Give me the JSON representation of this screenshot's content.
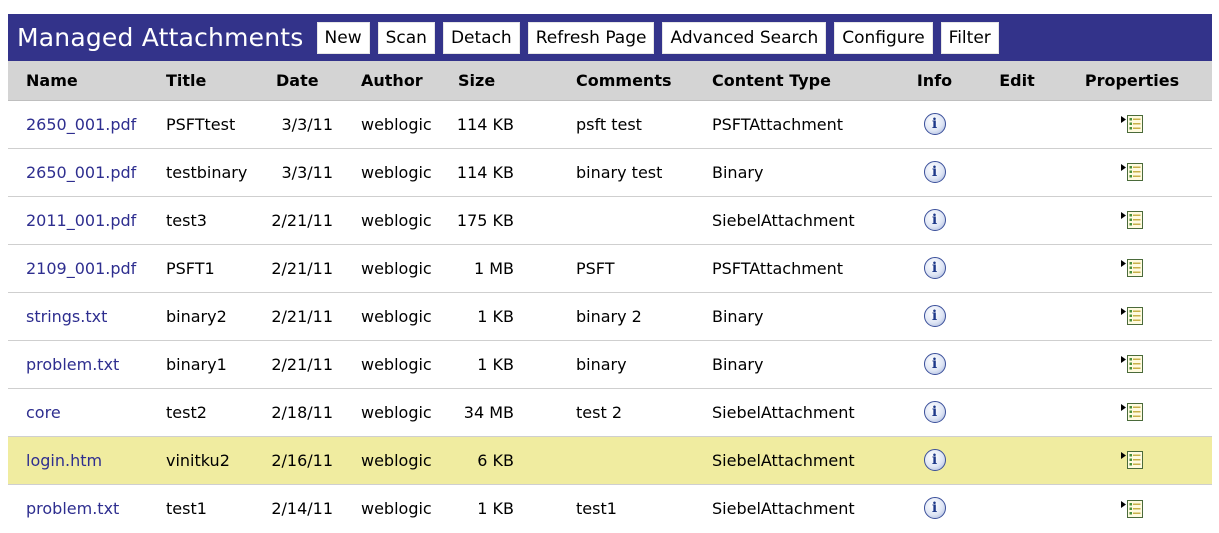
{
  "toolbar": {
    "title": "Managed Attachments",
    "buttons": [
      "New",
      "Scan",
      "Detach",
      "Refresh Page",
      "Advanced Search",
      "Configure",
      "Filter"
    ]
  },
  "table": {
    "headers": {
      "name": "Name",
      "title": "Title",
      "date": "Date",
      "author": "Author",
      "size": "Size",
      "comments": "Comments",
      "content_type": "Content Type",
      "info": "Info",
      "edit": "Edit",
      "properties": "Properties"
    },
    "rows": [
      {
        "name": "2650_001.pdf",
        "title": "PSFTtest",
        "date": "3/3/11",
        "author": "weblogic",
        "size": "114 KB",
        "comments": "psft test",
        "content_type": "PSFTAttachment"
      },
      {
        "name": "2650_001.pdf",
        "title": "testbinary",
        "date": "3/3/11",
        "author": "weblogic",
        "size": "114 KB",
        "comments": "binary test",
        "content_type": "Binary"
      },
      {
        "name": "2011_001.pdf",
        "title": "test3",
        "date": "2/21/11",
        "author": "weblogic",
        "size": "175 KB",
        "comments": "",
        "content_type": "SiebelAttachment"
      },
      {
        "name": "2109_001.pdf",
        "title": "PSFT1",
        "date": "2/21/11",
        "author": "weblogic",
        "size": "1 MB",
        "comments": "PSFT",
        "content_type": "PSFTAttachment"
      },
      {
        "name": "strings.txt",
        "title": "binary2",
        "date": "2/21/11",
        "author": "weblogic",
        "size": "1 KB",
        "comments": "binary 2",
        "content_type": "Binary"
      },
      {
        "name": "problem.txt",
        "title": "binary1",
        "date": "2/21/11",
        "author": "weblogic",
        "size": "1 KB",
        "comments": "binary",
        "content_type": "Binary"
      },
      {
        "name": "core",
        "title": "test2",
        "date": "2/18/11",
        "author": "weblogic",
        "size": "34 MB",
        "comments": "test 2",
        "content_type": "SiebelAttachment"
      },
      {
        "name": "login.htm",
        "title": "vinitku2",
        "date": "2/16/11",
        "author": "weblogic",
        "size": "6 KB",
        "comments": "",
        "content_type": "SiebelAttachment",
        "selected": true
      },
      {
        "name": "problem.txt",
        "title": "test1",
        "date": "2/14/11",
        "author": "weblogic",
        "size": "1 KB",
        "comments": "test1",
        "content_type": "SiebelAttachment"
      }
    ],
    "info_icon": "info-icon",
    "properties_icon": "properties-icon"
  },
  "colors": {
    "title_bar": "#33338a",
    "header_bg": "#d4d4d4",
    "link": "#2e2e8f",
    "selected_row": "#f0eca0"
  }
}
